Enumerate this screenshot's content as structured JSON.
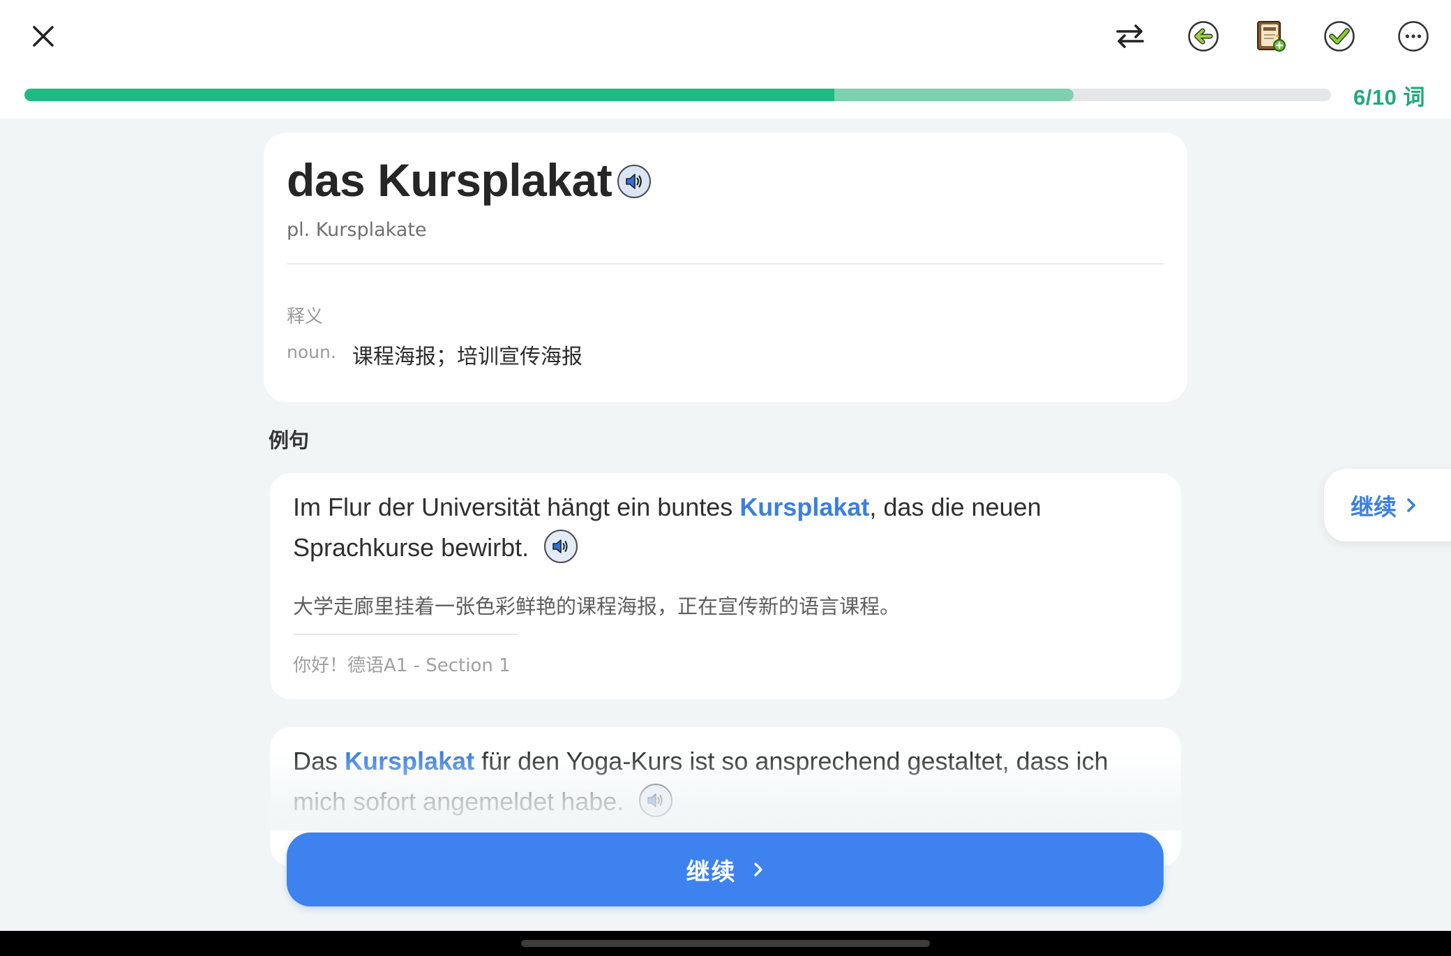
{
  "header": {
    "close_icon": "close-icon",
    "actions": [
      {
        "name": "swap-icon"
      },
      {
        "name": "back-icon"
      },
      {
        "name": "wordbook-icon"
      },
      {
        "name": "check-icon"
      },
      {
        "name": "more-icon"
      }
    ],
    "progress": {
      "completed_fraction": 0.62,
      "buffered_fraction": 0.803,
      "count_text": "6/10 词"
    }
  },
  "word": {
    "title": "das Kursplakat",
    "plural": "pl. Kursplakate",
    "definition_label": "释义",
    "part_of_speech": "noun.",
    "meaning": "课程海报；培训宣传海报"
  },
  "examples": {
    "heading": "例句",
    "items": [
      {
        "before": "Im Flur der Universität hängt ein buntes ",
        "keyword": "Kursplakat",
        "after": ", das die neuen Sprachkurse bewirbt.",
        "translation": "大学走廊里挂着一张色彩鲜艳的课程海报，正在宣传新的语言课程。",
        "source": "你好！德语A1 - Section 1"
      },
      {
        "before": "Das ",
        "keyword": "Kursplakat",
        "after": " für den Yoga-Kurs ist so ansprechend gestaltet, dass ich mich sofort angemeldet habe."
      }
    ]
  },
  "side_continue": {
    "label": "继续"
  },
  "continue_button": {
    "label": "继续"
  },
  "colors": {
    "accent_blue": "#3d82ee",
    "keyword_blue": "#3b7fe0",
    "progress_green": "#1fba84",
    "progress_buffer": "#7fcfb1"
  }
}
